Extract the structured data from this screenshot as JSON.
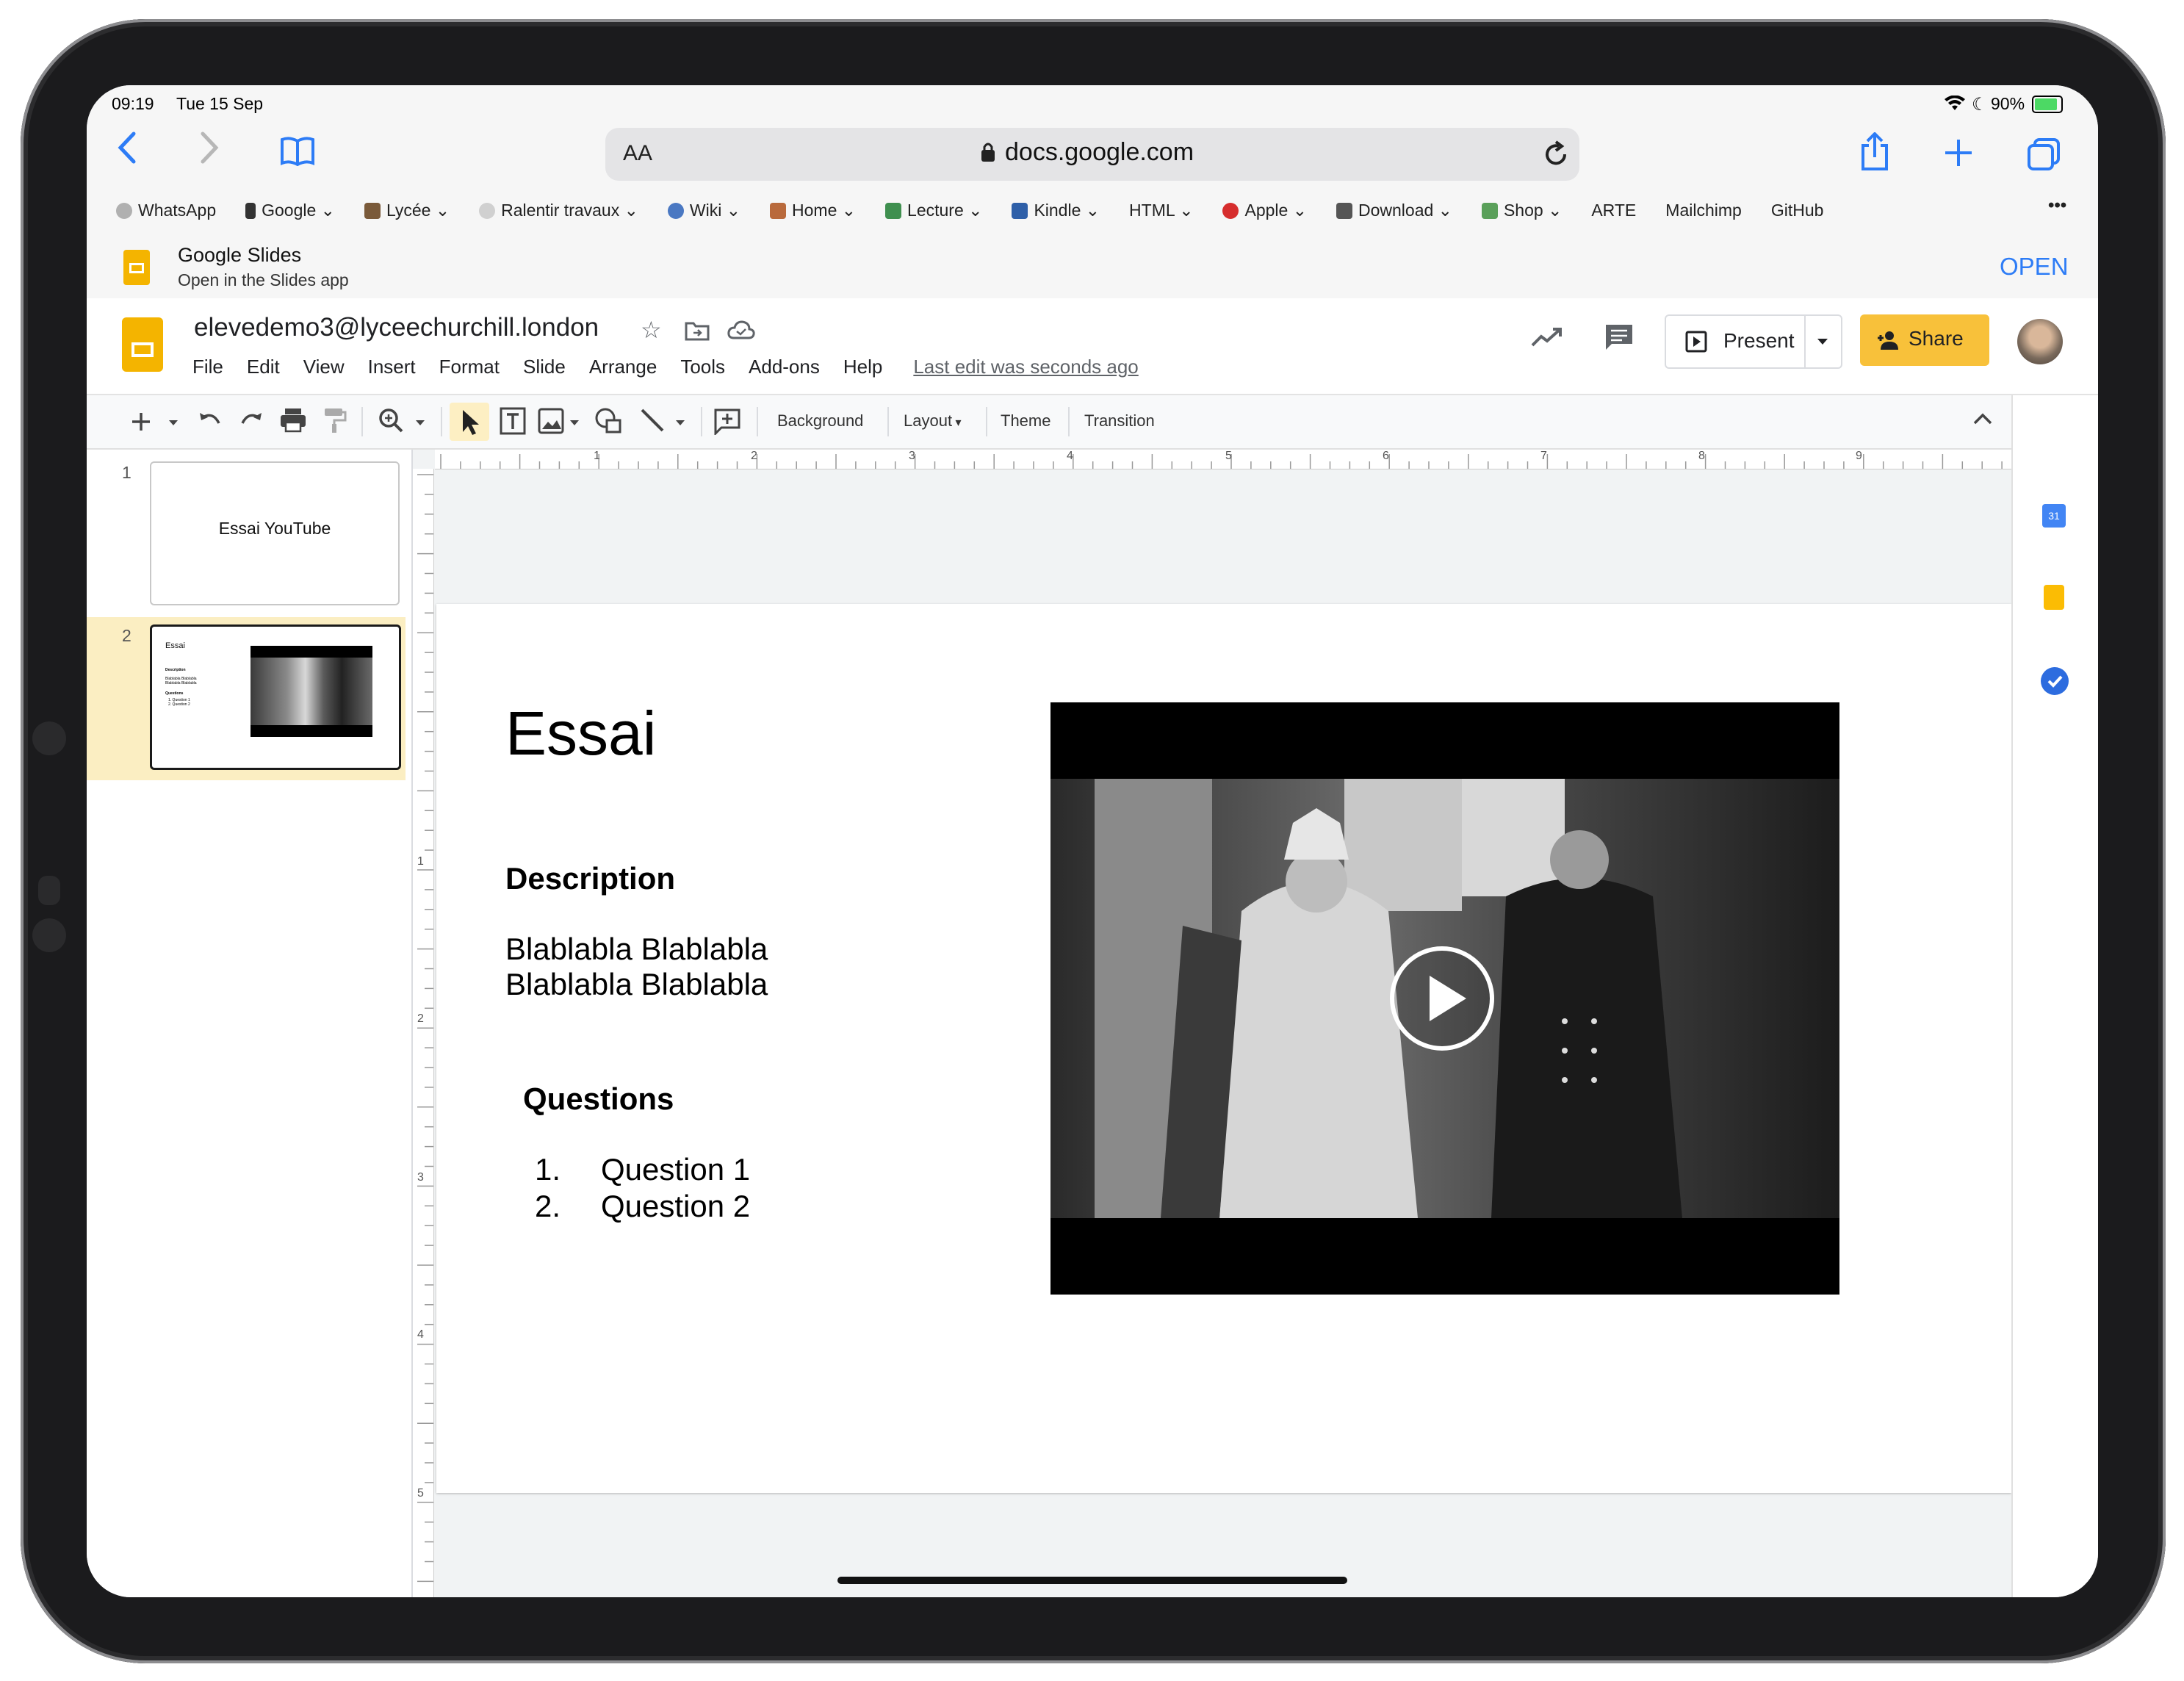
{
  "status": {
    "time": "09:19",
    "date": "Tue 15 Sep",
    "battery": "90%"
  },
  "safari": {
    "text_size_label": "AA",
    "url": "docs.google.com",
    "bookmarks": [
      {
        "label": "WhatsApp",
        "chevron": false,
        "color": "#9e9e9e"
      },
      {
        "label": "Google",
        "chevron": true,
        "color": "#333333"
      },
      {
        "label": "Lycée",
        "chevron": true,
        "color": "#7a5a3a"
      },
      {
        "label": "Ralentir travaux",
        "chevron": true,
        "color": "#c0c0c0"
      },
      {
        "label": "Wiki",
        "chevron": true,
        "color": "#4a78c2"
      },
      {
        "label": "Home",
        "chevron": true,
        "color": "#b96a3c"
      },
      {
        "label": "Lecture",
        "chevron": true,
        "color": "#3f8f4f"
      },
      {
        "label": "Kindle",
        "chevron": true,
        "color": "#2e5fa8"
      },
      {
        "label": "HTML",
        "chevron": true,
        "color": ""
      },
      {
        "label": "Apple",
        "chevron": true,
        "color": "#d62d2d"
      },
      {
        "label": "Download",
        "chevron": true,
        "color": "#555555"
      },
      {
        "label": "Shop",
        "chevron": true,
        "color": "#5aa05a"
      },
      {
        "label": "ARTE",
        "chevron": false,
        "color": ""
      },
      {
        "label": "Mailchimp",
        "chevron": false,
        "color": ""
      },
      {
        "label": "GitHub",
        "chevron": false,
        "color": ""
      }
    ],
    "more_label": "•••"
  },
  "banner": {
    "app_name": "Google Slides",
    "subtitle": "Open in the Slides app",
    "open_label": "OPEN"
  },
  "docs": {
    "title": "elevedemo3@lyceechurchill.london",
    "menu": [
      "File",
      "Edit",
      "View",
      "Insert",
      "Format",
      "Slide",
      "Arrange",
      "Tools",
      "Add-ons",
      "Help"
    ],
    "last_edit": "Last edit was seconds ago",
    "present_label": "Present",
    "share_label": "Share"
  },
  "toolbar": {
    "background": "Background",
    "layout": "Layout",
    "theme": "Theme",
    "transition": "Transition"
  },
  "ruler": {
    "h_ticks": [
      "1",
      "2",
      "3",
      "4",
      "5",
      "6",
      "7",
      "8",
      "9"
    ],
    "v_ticks": [
      "1",
      "2",
      "3",
      "4",
      "5"
    ]
  },
  "filmstrip": [
    {
      "number": "1",
      "title": "Essai YouTube"
    },
    {
      "number": "2",
      "title": "Essai",
      "mini_lines": [
        "Description",
        "Blablabla Blablabla",
        "Blablabla Blablabla",
        "Questions",
        "1. Question 1",
        "2. Question 2"
      ]
    }
  ],
  "slide": {
    "title": "Essai",
    "description_heading": "Description",
    "description_lines": [
      "Blablabla Blablabla",
      "Blablabla Blablabla"
    ],
    "questions_heading": "Questions",
    "questions": [
      {
        "num": "1.",
        "text": "Question 1"
      },
      {
        "num": "2.",
        "text": "Question 2"
      }
    ]
  },
  "colors": {
    "accent_blue": "#2d7cf6",
    "share_yellow": "#f8c13a",
    "selected_slide": "#fbeec2",
    "slides_icon": "#f4b400"
  }
}
